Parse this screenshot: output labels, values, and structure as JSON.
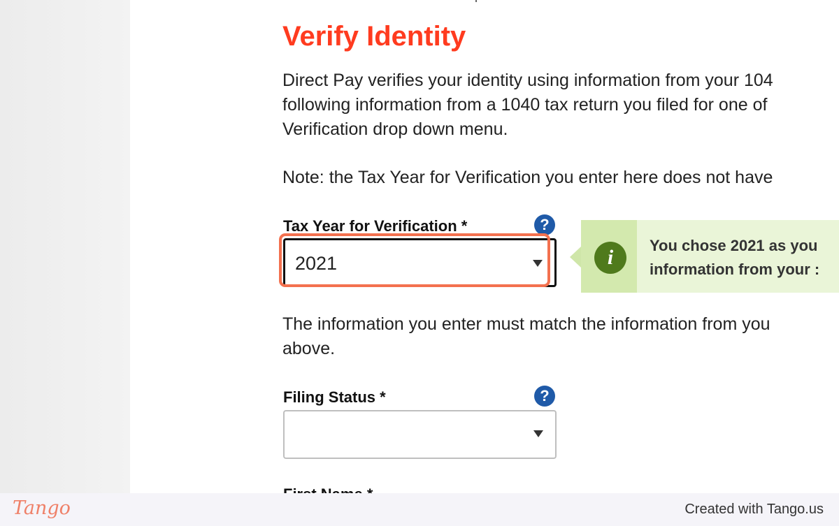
{
  "page": {
    "title": "Verify Identity",
    "intro_lines": [
      "Direct Pay verifies your identity using information from your 104",
      "following information from a 1040 tax return you filed for one of",
      "Verification drop down menu."
    ],
    "note": "Note: the Tax Year for Verification you enter here does not have",
    "match_lines": [
      "The information you enter must match the information from you",
      "above."
    ]
  },
  "form": {
    "tax_year": {
      "label": "Tax Year for Verification *",
      "value": "2021",
      "help": "?"
    },
    "filing_status": {
      "label": "Filing Status *",
      "value": "",
      "help": "?"
    },
    "first_name": {
      "label": "First Name *"
    }
  },
  "info": {
    "icon_glyph": "i",
    "lines": [
      "You chose 2021 as you",
      "information from your :"
    ]
  },
  "footer": {
    "brand": "Tango",
    "credit": "Created with Tango.us"
  },
  "colors": {
    "title": "#ff3b1f",
    "help_icon": "#1f5aa8",
    "highlight": "#f3714f",
    "info_icon": "#4f7a1c",
    "info_bg": "#eaf5d8"
  }
}
